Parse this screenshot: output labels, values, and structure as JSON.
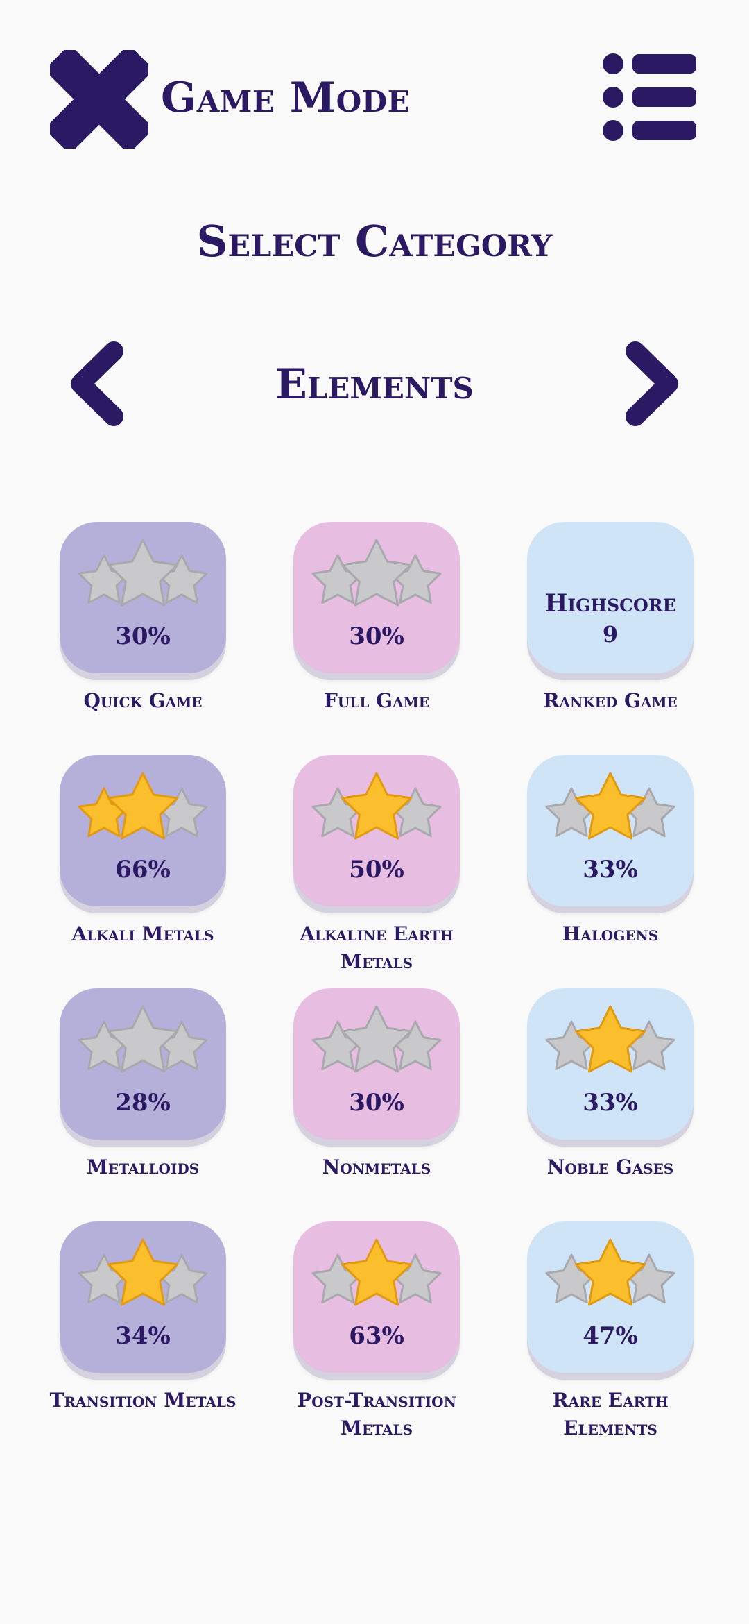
{
  "header": {
    "title": "Game Mode",
    "close_icon": "close-x-icon",
    "menu_icon": "list-menu-icon"
  },
  "heading": "Select Category",
  "category": {
    "name": "Elements",
    "prev_icon": "chevron-left-icon",
    "next_icon": "chevron-right-icon"
  },
  "colors": {
    "text": "#2b1a63",
    "purple_card": "#b4b0d9",
    "pink_card": "#e8bde2",
    "blue_card": "#cfe4f7",
    "star_gold": "#fbbf2d",
    "star_gray": "#c9c9cc"
  },
  "tiles": [
    {
      "label": "Quick Game",
      "percent": "30%",
      "stars": 0,
      "color": "purple"
    },
    {
      "label": "Full Game",
      "percent": "30%",
      "stars": 0,
      "color": "pink"
    },
    {
      "label": "Ranked Game",
      "highscore_label": "Highscore",
      "highscore_value": "9",
      "color": "blue"
    },
    {
      "label": "Alkali Metals",
      "percent": "66%",
      "stars": 2,
      "color": "purple"
    },
    {
      "label": "Alkaline Earth\nMetals",
      "percent": "50%",
      "stars": 1,
      "color": "pink"
    },
    {
      "label": "Halogens",
      "percent": "33%",
      "stars": 1,
      "color": "blue"
    },
    {
      "label": "Metalloids",
      "percent": "28%",
      "stars": 0,
      "color": "purple"
    },
    {
      "label": "Nonmetals",
      "percent": "30%",
      "stars": 0,
      "color": "pink"
    },
    {
      "label": "Noble Gases",
      "percent": "33%",
      "stars": 1,
      "color": "blue"
    },
    {
      "label": "Transition Metals",
      "percent": "34%",
      "stars": 1,
      "color": "purple"
    },
    {
      "label": "Post-Transition\nMetals",
      "percent": "63%",
      "stars": 1,
      "color": "pink"
    },
    {
      "label": "Rare Earth\nElements",
      "percent": "47%",
      "stars": 1,
      "color": "blue"
    }
  ]
}
